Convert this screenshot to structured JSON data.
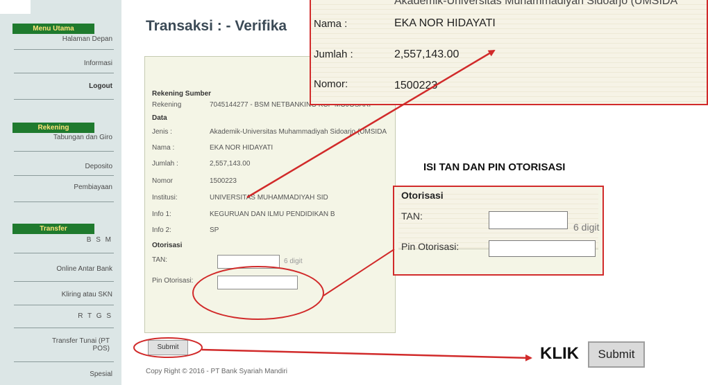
{
  "sidebar": {
    "menu_utama": "Menu Utama",
    "halaman_depan": "Halaman Depan",
    "informasi": "Informasi",
    "logout": "Logout",
    "rekening": "Rekening",
    "tabungan_giro": "Tabungan dan Giro",
    "deposito": "Deposito",
    "pembiayaan": "Pembiayaan",
    "transfer": "Transfer",
    "bsm": "B S M",
    "online_antar_bank": "Online Antar Bank",
    "kliring_skn": "Kliring atau SKN",
    "rtgs": "R T G S",
    "transfer_tunai": "Transfer Tunai (PT POS)",
    "spesial": "Spesial"
  },
  "main": {
    "title": "Transaksi : - Verifika",
    "panel_title": "Verifik",
    "rekening_sumber": "Rekening Sumber",
    "rekening_label": "Rekening",
    "rekening_value": "7045144277 - BSM NETBANKING KCP MOJOSARI",
    "data_label": "Data",
    "jenis_label": "Jenis :",
    "jenis_value": "Akademik-Universitas Muhammadiyah Sidoarjo (UMSIDA",
    "nama_label": "Nama :",
    "nama_value": "EKA NOR HIDAYATI",
    "jumlah_label": "Jumlah :",
    "jumlah_value": "2,557,143.00",
    "nomor_label": "Nomor",
    "nomor_value": "1500223",
    "institusi_label": "Institusi:",
    "institusi_value": "UNIVERSITAS MUHAMMADIYAH SID",
    "info1_label": "Info 1:",
    "info1_value": "KEGURUAN DAN ILMU PENDIDIKAN B",
    "info2_label": "Info 2:",
    "info2_value": "SP",
    "otorisasi_label": "Otorisasi",
    "tan_label": "TAN:",
    "tan_hint": "6 digit",
    "pin_label": "Pin Otorisasi:",
    "submit": "Submit",
    "copyright": "Copy Right © 2016 - PT Bank Syariah Mandiri"
  },
  "zoom": {
    "top_text": "Akademik-Universitas Muhammadiyah Sidoarjo (UMSIDA",
    "nama_label": "Nama :",
    "nama_value": "EKA NOR HIDAYATI",
    "jumlah_label": "Jumlah :",
    "jumlah_value": "2,557,143.00",
    "nomor_label": "Nomor:",
    "nomor_value": "1500223"
  },
  "callout": {
    "heading": "ISI TAN DAN PIN OTORISASI",
    "otorisasi": "Otorisasi",
    "tan_label": "TAN:",
    "digit_hint": "6 digit",
    "pin_label": "Pin Otorisasi:"
  },
  "klik": {
    "label": "KLIK",
    "submit": "Submit"
  },
  "colors": {
    "annotation_red": "#d12a2a",
    "sidebar_header_green": "#1f7a2e",
    "sidebar_header_text": "#ffe37a"
  }
}
